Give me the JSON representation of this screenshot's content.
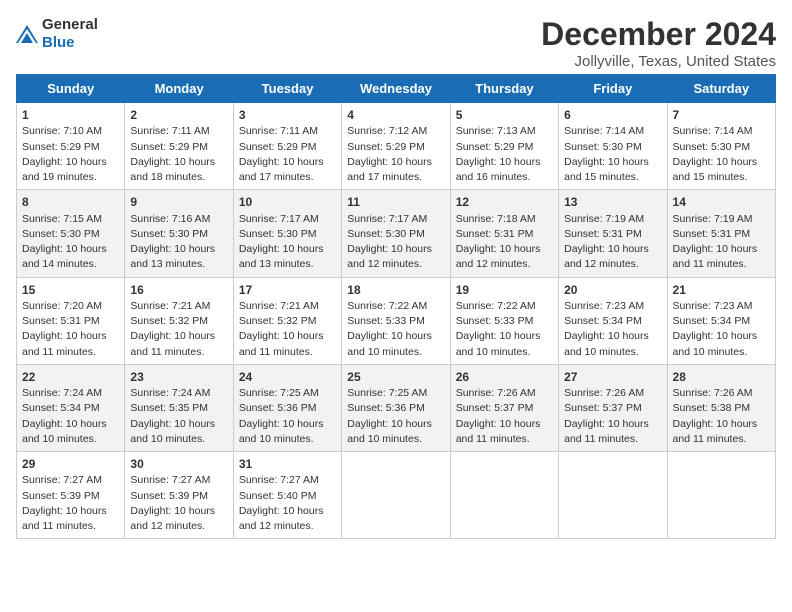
{
  "header": {
    "logo_general": "General",
    "logo_blue": "Blue",
    "month_title": "December 2024",
    "location": "Jollyville, Texas, United States"
  },
  "days_of_week": [
    "Sunday",
    "Monday",
    "Tuesday",
    "Wednesday",
    "Thursday",
    "Friday",
    "Saturday"
  ],
  "weeks": [
    [
      {
        "day": "1",
        "sunrise": "Sunrise: 7:10 AM",
        "sunset": "Sunset: 5:29 PM",
        "daylight": "Daylight: 10 hours and 19 minutes."
      },
      {
        "day": "2",
        "sunrise": "Sunrise: 7:11 AM",
        "sunset": "Sunset: 5:29 PM",
        "daylight": "Daylight: 10 hours and 18 minutes."
      },
      {
        "day": "3",
        "sunrise": "Sunrise: 7:11 AM",
        "sunset": "Sunset: 5:29 PM",
        "daylight": "Daylight: 10 hours and 17 minutes."
      },
      {
        "day": "4",
        "sunrise": "Sunrise: 7:12 AM",
        "sunset": "Sunset: 5:29 PM",
        "daylight": "Daylight: 10 hours and 17 minutes."
      },
      {
        "day": "5",
        "sunrise": "Sunrise: 7:13 AM",
        "sunset": "Sunset: 5:29 PM",
        "daylight": "Daylight: 10 hours and 16 minutes."
      },
      {
        "day": "6",
        "sunrise": "Sunrise: 7:14 AM",
        "sunset": "Sunset: 5:30 PM",
        "daylight": "Daylight: 10 hours and 15 minutes."
      },
      {
        "day": "7",
        "sunrise": "Sunrise: 7:14 AM",
        "sunset": "Sunset: 5:30 PM",
        "daylight": "Daylight: 10 hours and 15 minutes."
      }
    ],
    [
      {
        "day": "8",
        "sunrise": "Sunrise: 7:15 AM",
        "sunset": "Sunset: 5:30 PM",
        "daylight": "Daylight: 10 hours and 14 minutes."
      },
      {
        "day": "9",
        "sunrise": "Sunrise: 7:16 AM",
        "sunset": "Sunset: 5:30 PM",
        "daylight": "Daylight: 10 hours and 13 minutes."
      },
      {
        "day": "10",
        "sunrise": "Sunrise: 7:17 AM",
        "sunset": "Sunset: 5:30 PM",
        "daylight": "Daylight: 10 hours and 13 minutes."
      },
      {
        "day": "11",
        "sunrise": "Sunrise: 7:17 AM",
        "sunset": "Sunset: 5:30 PM",
        "daylight": "Daylight: 10 hours and 12 minutes."
      },
      {
        "day": "12",
        "sunrise": "Sunrise: 7:18 AM",
        "sunset": "Sunset: 5:31 PM",
        "daylight": "Daylight: 10 hours and 12 minutes."
      },
      {
        "day": "13",
        "sunrise": "Sunrise: 7:19 AM",
        "sunset": "Sunset: 5:31 PM",
        "daylight": "Daylight: 10 hours and 12 minutes."
      },
      {
        "day": "14",
        "sunrise": "Sunrise: 7:19 AM",
        "sunset": "Sunset: 5:31 PM",
        "daylight": "Daylight: 10 hours and 11 minutes."
      }
    ],
    [
      {
        "day": "15",
        "sunrise": "Sunrise: 7:20 AM",
        "sunset": "Sunset: 5:31 PM",
        "daylight": "Daylight: 10 hours and 11 minutes."
      },
      {
        "day": "16",
        "sunrise": "Sunrise: 7:21 AM",
        "sunset": "Sunset: 5:32 PM",
        "daylight": "Daylight: 10 hours and 11 minutes."
      },
      {
        "day": "17",
        "sunrise": "Sunrise: 7:21 AM",
        "sunset": "Sunset: 5:32 PM",
        "daylight": "Daylight: 10 hours and 11 minutes."
      },
      {
        "day": "18",
        "sunrise": "Sunrise: 7:22 AM",
        "sunset": "Sunset: 5:33 PM",
        "daylight": "Daylight: 10 hours and 10 minutes."
      },
      {
        "day": "19",
        "sunrise": "Sunrise: 7:22 AM",
        "sunset": "Sunset: 5:33 PM",
        "daylight": "Daylight: 10 hours and 10 minutes."
      },
      {
        "day": "20",
        "sunrise": "Sunrise: 7:23 AM",
        "sunset": "Sunset: 5:34 PM",
        "daylight": "Daylight: 10 hours and 10 minutes."
      },
      {
        "day": "21",
        "sunrise": "Sunrise: 7:23 AM",
        "sunset": "Sunset: 5:34 PM",
        "daylight": "Daylight: 10 hours and 10 minutes."
      }
    ],
    [
      {
        "day": "22",
        "sunrise": "Sunrise: 7:24 AM",
        "sunset": "Sunset: 5:34 PM",
        "daylight": "Daylight: 10 hours and 10 minutes."
      },
      {
        "day": "23",
        "sunrise": "Sunrise: 7:24 AM",
        "sunset": "Sunset: 5:35 PM",
        "daylight": "Daylight: 10 hours and 10 minutes."
      },
      {
        "day": "24",
        "sunrise": "Sunrise: 7:25 AM",
        "sunset": "Sunset: 5:36 PM",
        "daylight": "Daylight: 10 hours and 10 minutes."
      },
      {
        "day": "25",
        "sunrise": "Sunrise: 7:25 AM",
        "sunset": "Sunset: 5:36 PM",
        "daylight": "Daylight: 10 hours and 10 minutes."
      },
      {
        "day": "26",
        "sunrise": "Sunrise: 7:26 AM",
        "sunset": "Sunset: 5:37 PM",
        "daylight": "Daylight: 10 hours and 11 minutes."
      },
      {
        "day": "27",
        "sunrise": "Sunrise: 7:26 AM",
        "sunset": "Sunset: 5:37 PM",
        "daylight": "Daylight: 10 hours and 11 minutes."
      },
      {
        "day": "28",
        "sunrise": "Sunrise: 7:26 AM",
        "sunset": "Sunset: 5:38 PM",
        "daylight": "Daylight: 10 hours and 11 minutes."
      }
    ],
    [
      {
        "day": "29",
        "sunrise": "Sunrise: 7:27 AM",
        "sunset": "Sunset: 5:39 PM",
        "daylight": "Daylight: 10 hours and 11 minutes."
      },
      {
        "day": "30",
        "sunrise": "Sunrise: 7:27 AM",
        "sunset": "Sunset: 5:39 PM",
        "daylight": "Daylight: 10 hours and 12 minutes."
      },
      {
        "day": "31",
        "sunrise": "Sunrise: 7:27 AM",
        "sunset": "Sunset: 5:40 PM",
        "daylight": "Daylight: 10 hours and 12 minutes."
      },
      null,
      null,
      null,
      null
    ]
  ]
}
